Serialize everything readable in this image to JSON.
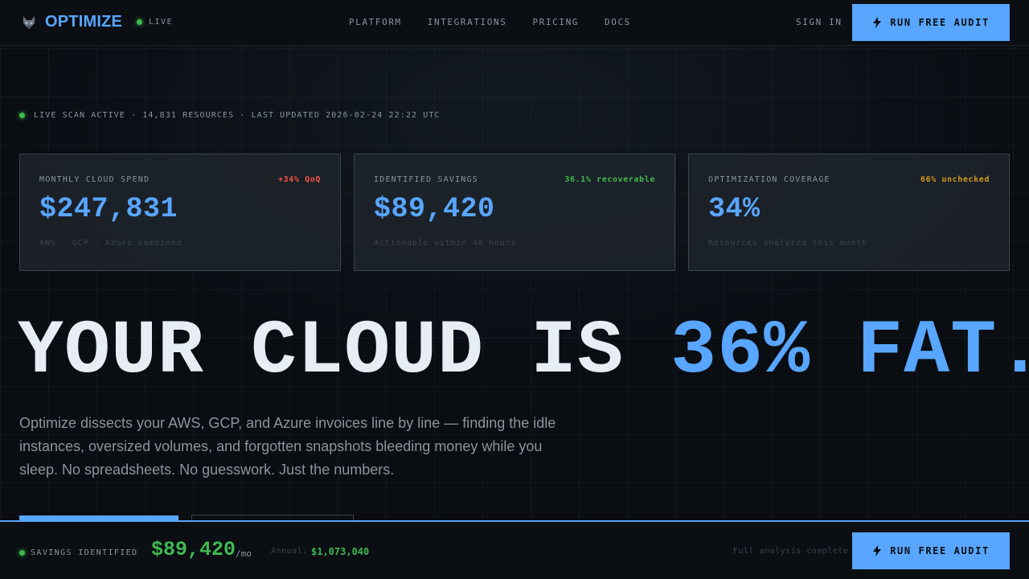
{
  "nav": {
    "brand_name": "OPTIMIZE",
    "live_label": "LIVE",
    "links": [
      "PLATFORM",
      "INTEGRATIONS",
      "PRICING",
      "DOCS"
    ],
    "sign_in": "SIGN IN",
    "cta": "RUN FREE AUDIT"
  },
  "status": {
    "text": "LIVE SCAN ACTIVE · 14,831 RESOURCES · LAST UPDATED 2026-02-24 22:22 UTC"
  },
  "cards": [
    {
      "label": "MONTHLY CLOUD SPEND",
      "badge": "+34% QoQ",
      "badge_color": "#f85149",
      "value": "$247,831",
      "sub": "AWS · GCP · Azure combined"
    },
    {
      "label": "IDENTIFIED SAVINGS",
      "badge": "36.1% recoverable",
      "badge_color": "#3fb950",
      "value": "$89,420",
      "sub": "Actionable within 48 hours"
    },
    {
      "label": "OPTIMIZATION COVERAGE",
      "badge": "66% unchecked",
      "badge_color": "#d29922",
      "value": "34%",
      "sub": "Resources analyzed this month"
    }
  ],
  "hero": {
    "part1": "YOUR CLOUD IS ",
    "accent": "36% FAT.",
    "description": "Optimize dissects your AWS, GCP, and Azure invoices line by line — finding the idle instances, oversized volumes, and forgotten snapshots bleeding money while you sleep. No spreadsheets. No guesswork. Just the numbers."
  },
  "footer": {
    "label": "SAVINGS IDENTIFIED",
    "amount": "$89,420",
    "per": "/mo",
    "annual_label": "Annual:",
    "annual_value": "$1,073,040",
    "complete": "Full analysis complete",
    "cta": "RUN FREE AUDIT"
  },
  "colors": {
    "accent": "#58a6ff",
    "success": "#3fb950",
    "danger": "#f85149",
    "warning": "#d29922",
    "background": "#0a0d12"
  },
  "icons": {
    "brand": "wolf-logo-icon",
    "cta": "lightning-bolt-icon",
    "live": "status-dot-icon"
  }
}
